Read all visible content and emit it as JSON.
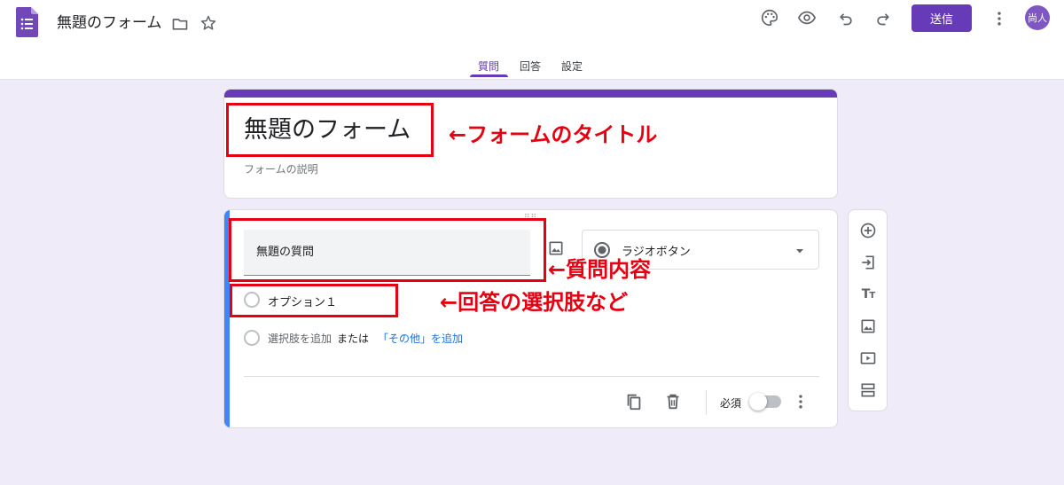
{
  "header": {
    "doc_title": "無題のフォーム",
    "send_label": "送信",
    "avatar_text": "尚人",
    "tabs": [
      {
        "label": "質問",
        "active": true
      },
      {
        "label": "回答",
        "active": false
      },
      {
        "label": "設定",
        "active": false
      }
    ]
  },
  "title_card": {
    "title": "無題のフォーム",
    "description_placeholder": "フォームの説明"
  },
  "question": {
    "title": "無題の質問",
    "type": "ラジオボタン",
    "options": [
      "オプション１"
    ],
    "add_option": "選択肢を追加",
    "or": "または",
    "add_other": "「その他」を追加",
    "required_label": "必須",
    "required": false
  },
  "annotations": {
    "title": "←フォームのタイトル",
    "question": "←質問内容",
    "options": "←回答の選択肢など"
  },
  "colors": {
    "accent": "#673ab7",
    "background": "#f0ebf8",
    "active_card": "#4285f4",
    "annotation": "#e60012"
  }
}
